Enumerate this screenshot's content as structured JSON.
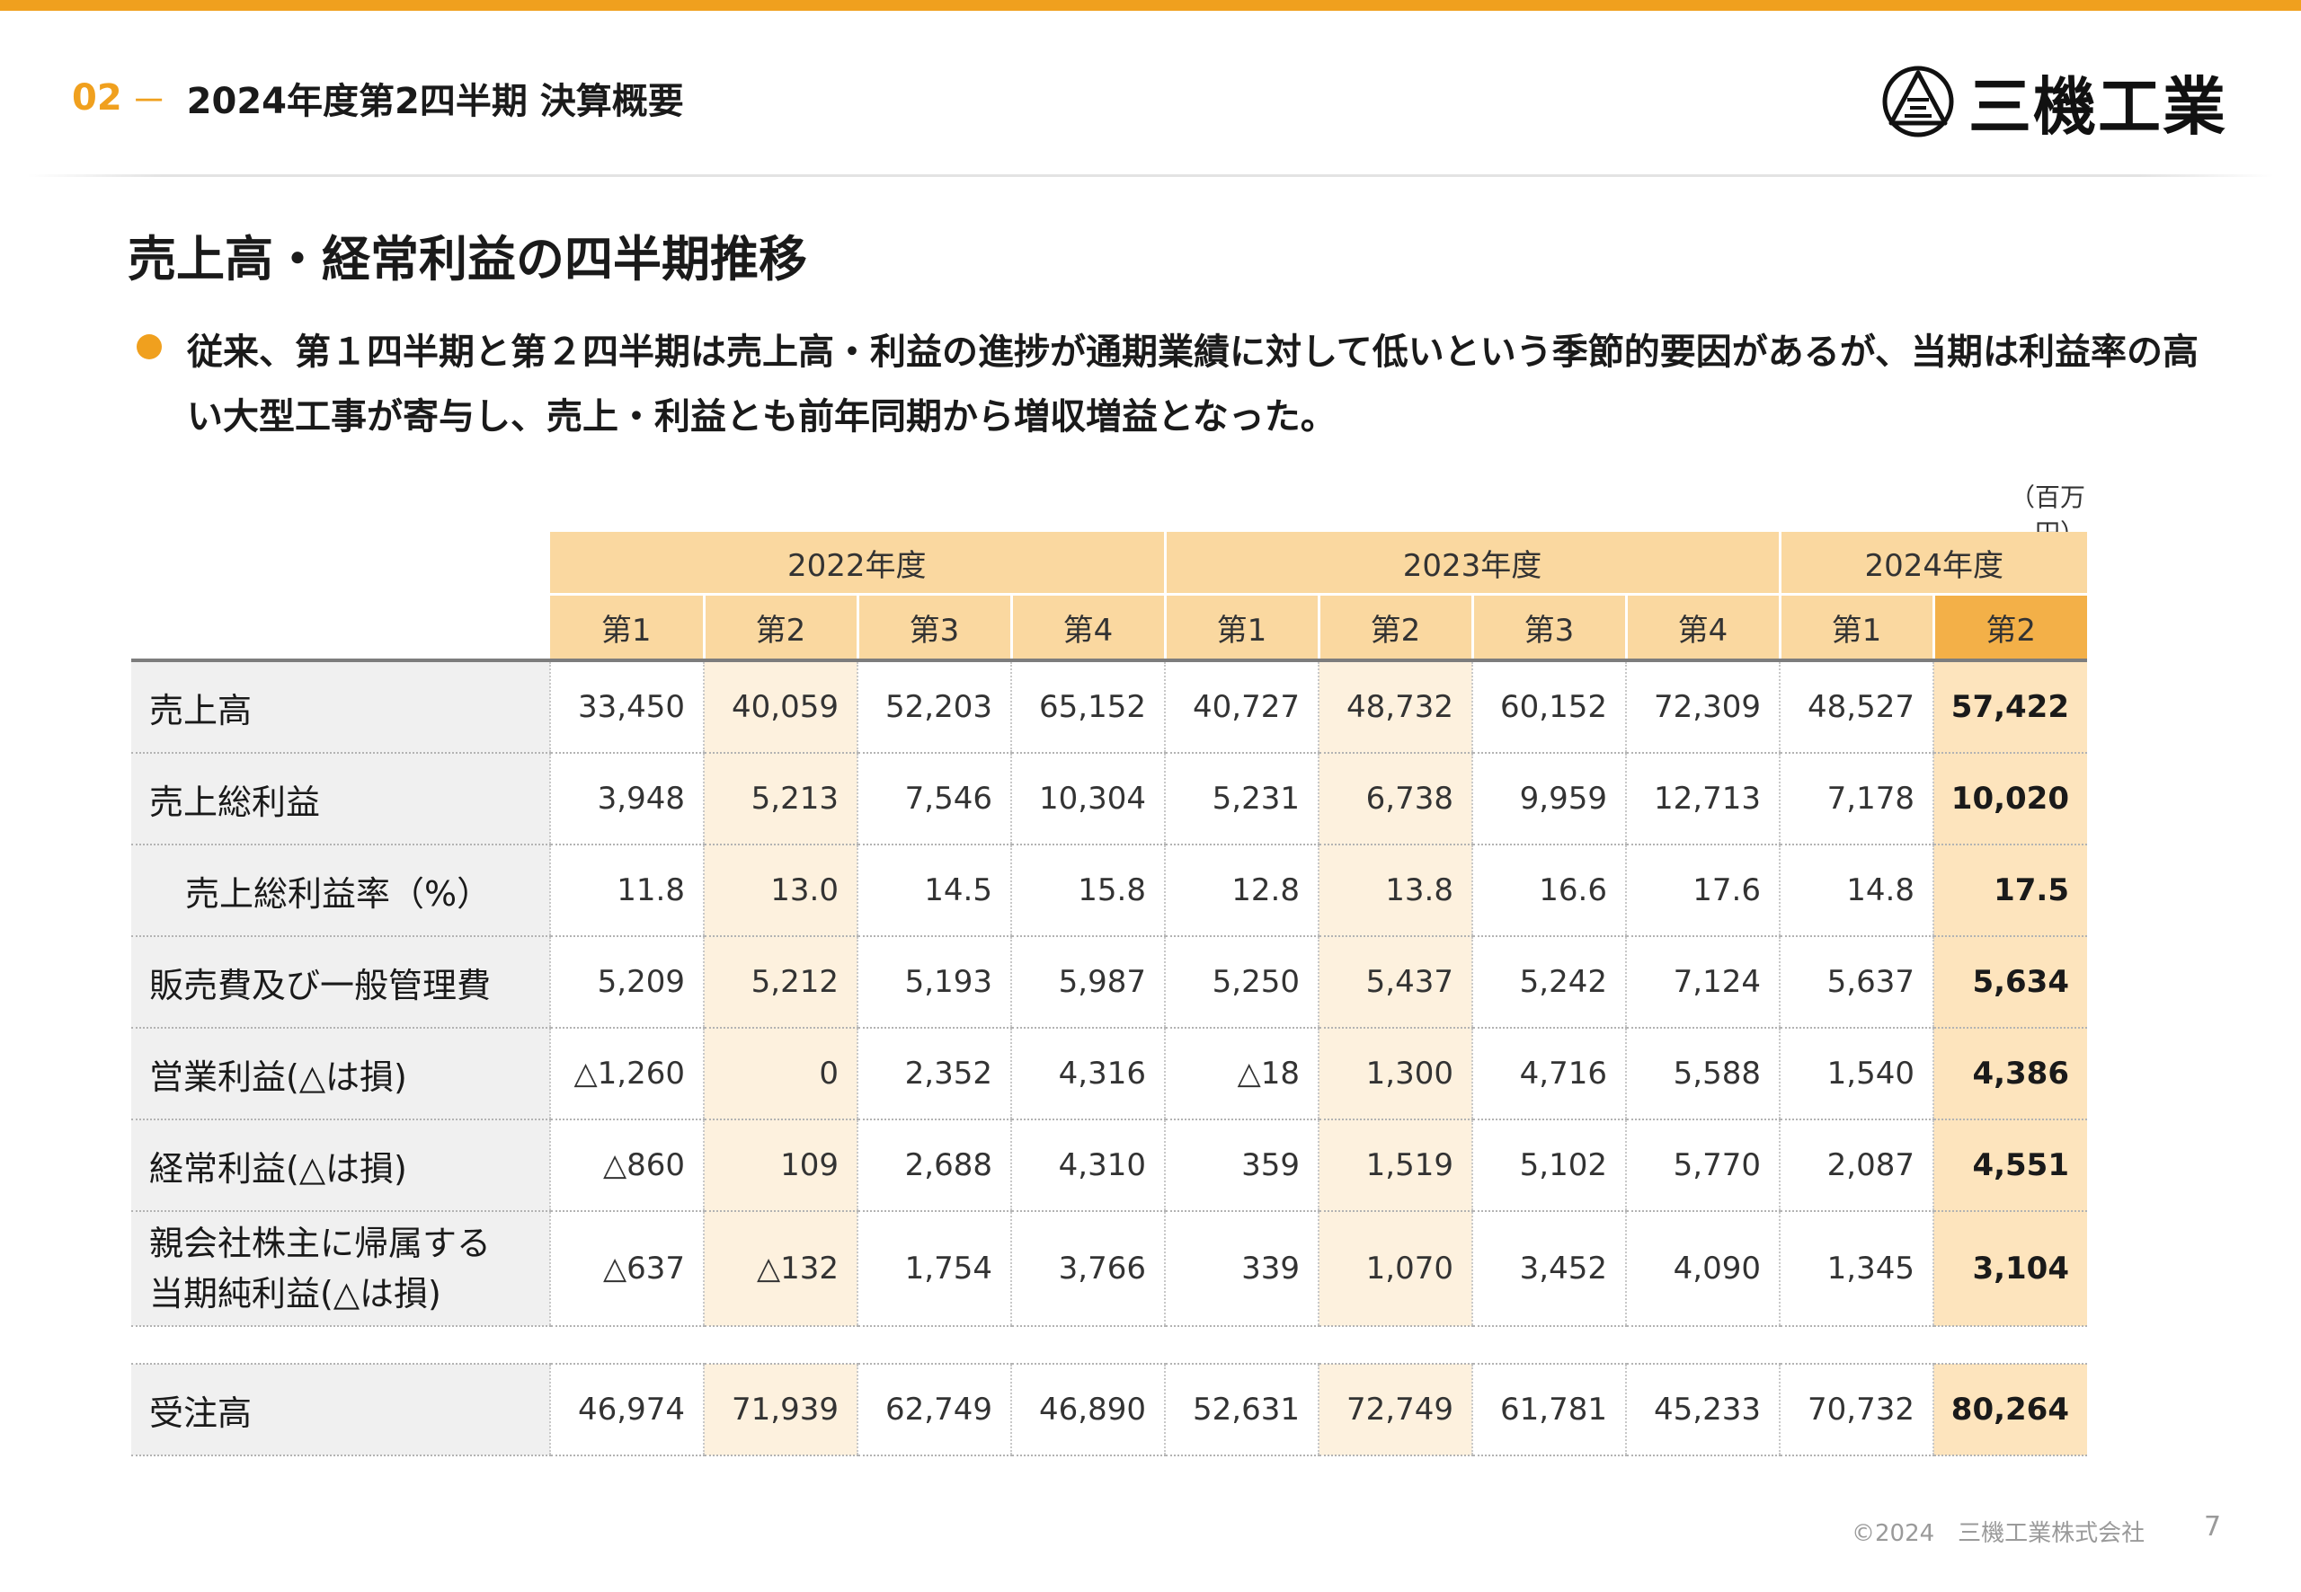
{
  "header": {
    "section_number": "02",
    "section_dash": "－",
    "title": "2024年度第2四半期 決算概要"
  },
  "logo": {
    "text": "三機工業",
    "mark_icon": "sanki-triangle-logo-icon"
  },
  "main": {
    "section_title": "売上高・経常利益の四半期推移",
    "description": "従来、第１四半期と第２四半期は売上高・利益の進捗が通期業績に対して低いという季節的要因があるが、当期は利益率の高い大型工事が寄与し、売上・利益とも前年同期から増収増益となった。",
    "unit": "（百万円）"
  },
  "table": {
    "years": [
      "2022年度",
      "2023年度",
      "2024年度"
    ],
    "quarters": [
      "第1",
      "第2",
      "第3",
      "第4",
      "第1",
      "第2",
      "第3",
      "第4",
      "第1",
      "第2"
    ],
    "rows": [
      {
        "label": "売上高",
        "values": [
          "33,450",
          "40,059",
          "52,203",
          "65,152",
          "40,727",
          "48,732",
          "60,152",
          "72,309",
          "48,527",
          "57,422"
        ]
      },
      {
        "label": "売上総利益",
        "values": [
          "3,948",
          "5,213",
          "7,546",
          "10,304",
          "5,231",
          "6,738",
          "9,959",
          "12,713",
          "7,178",
          "10,020"
        ]
      },
      {
        "label": "売上総利益率（%）",
        "values": [
          "11.8",
          "13.0",
          "14.5",
          "15.8",
          "12.8",
          "13.8",
          "16.6",
          "17.6",
          "14.8",
          "17.5"
        ]
      },
      {
        "label": "販売費及び一般管理費",
        "values": [
          "5,209",
          "5,212",
          "5,193",
          "5,987",
          "5,250",
          "5,437",
          "5,242",
          "7,124",
          "5,637",
          "5,634"
        ]
      },
      {
        "label": "営業利益(△は損)",
        "values": [
          "△1,260",
          "0",
          "2,352",
          "4,316",
          "△18",
          "1,300",
          "4,716",
          "5,588",
          "1,540",
          "4,386"
        ]
      },
      {
        "label": "経常利益(△は損)",
        "values": [
          "△860",
          "109",
          "2,688",
          "4,310",
          "359",
          "1,519",
          "5,102",
          "5,770",
          "2,087",
          "4,551"
        ]
      },
      {
        "label_line1": "親会社株主に帰属する",
        "label_line2": "当期純利益(△は損)",
        "values": [
          "△637",
          "△132",
          "1,754",
          "3,766",
          "339",
          "1,070",
          "3,452",
          "4,090",
          "1,345",
          "3,104"
        ]
      }
    ],
    "orders": {
      "label": "受注高",
      "values": [
        "46,974",
        "71,939",
        "62,749",
        "46,890",
        "52,631",
        "72,749",
        "61,781",
        "45,233",
        "70,732",
        "80,264"
      ]
    }
  },
  "footer": {
    "copyright": "©2024　三機工業株式会社",
    "page_number": "7"
  },
  "colors": {
    "accent": "#f0a01e",
    "header_cell": "#fad8a0",
    "current_quarter": "#f3b048",
    "q2_highlight": "#fdf1de",
    "current_highlight": "#fde4bd"
  }
}
